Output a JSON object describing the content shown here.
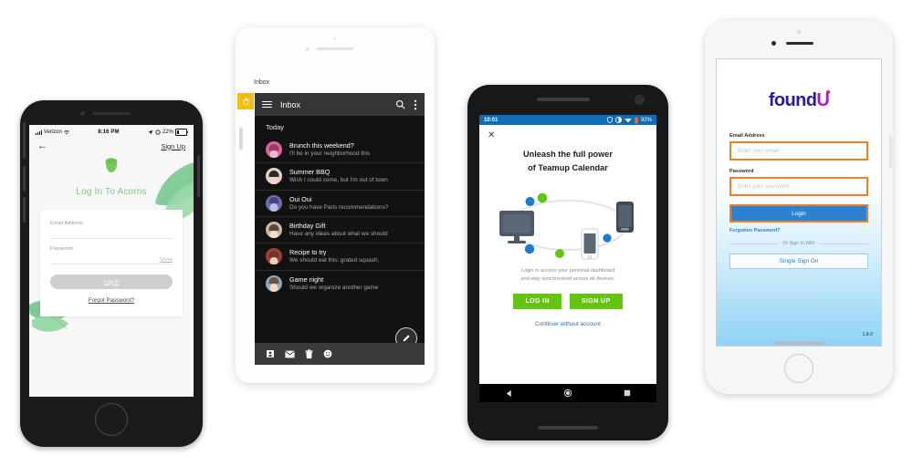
{
  "scene": {
    "title": "Four mobile app login / inbox screens",
    "background": "#ffffff"
  },
  "phones": [
    {
      "id": "acorns",
      "device": "iPhone (space gray)",
      "app": "Acorns",
      "status_bar": {
        "carrier": "Verizon",
        "time": "8:16 PM",
        "battery": "22%"
      },
      "nav": {
        "back_icon": "arrow-left-icon",
        "signup_label": "Sign Up"
      },
      "hero": {
        "logo_icon": "acorn-icon",
        "title": "Log In To Acorns",
        "title_color": "#7dc785"
      },
      "form": {
        "email_label": "Email Address",
        "password_label": "Password",
        "show_label": "Show",
        "login_label": "Log In",
        "forgot_label": "Forgot Password?",
        "button_color": "#cfcfcf"
      }
    },
    {
      "id": "inbox",
      "device": "White phone",
      "app": "Inbox",
      "outer_label": "Inbox",
      "badge_icon": "bag-icon",
      "badge_color": "#f5bc15",
      "appbar": {
        "menu_icon": "hamburger-menu-icon",
        "title": "Inbox",
        "search_icon": "search-icon",
        "overflow_icon": "more-vertical-icon",
        "background": "#353535"
      },
      "section_header": "Today",
      "messages": [
        {
          "subject": "Brunch this weekend?",
          "preview": "I'll be in your neighborhood this",
          "avatar_color": "#e0629c"
        },
        {
          "subject": "Summer BBQ",
          "preview": "Wish I could come, but I'm out of town",
          "avatar_color": "#e8cfc4"
        },
        {
          "subject": "Oui Oui",
          "preview": "Do you have Paris recommendations?",
          "avatar_color": "#6b6fb5"
        },
        {
          "subject": "Birthday Gift",
          "preview": "Have any ideas about what we should",
          "avatar_color": "#cbb7a6"
        },
        {
          "subject": "Recipe to try",
          "preview": "We should eat this: grated squash,",
          "avatar_color": "#a33b3b"
        },
        {
          "subject": "Game night",
          "preview": "Should we organize another game",
          "avatar_color": "#8fa8c4"
        }
      ],
      "bottom_toolbar": [
        {
          "icon": "contact-card-icon"
        },
        {
          "icon": "envelope-icon"
        },
        {
          "icon": "trash-icon"
        },
        {
          "icon": "smiley-icon"
        }
      ],
      "fab_icon": "compose-pen-icon"
    },
    {
      "id": "teamup",
      "device": "Android phone (black)",
      "app": "Teamup Calendar",
      "status_bar": {
        "time": "10:01",
        "battery": "92%",
        "background": "#0f6cb5"
      },
      "close_icon": "close-icon",
      "headline_line1": "Unleash the full power",
      "headline_line2": "of Teamup Calendar",
      "illustration": {
        "name": "devices-sync-illustration",
        "devices": [
          "desktop-monitor-icon",
          "phone-icon",
          "phone-icon"
        ],
        "dot_colors": [
          "#1f7ad6",
          "#63c510"
        ]
      },
      "subtext_line1": "Login to access your personal dashboard",
      "subtext_line2": "and stay synchronized across all devices.",
      "buttons": {
        "login_label": "LOG IN",
        "signup_label": "SIGN UP",
        "color": "#63c510"
      },
      "continue_label": "Continue without account",
      "continue_color": "#2d6fb8",
      "navbar": [
        "back-triangle-icon",
        "home-circle-icon",
        "recents-square-icon"
      ]
    },
    {
      "id": "foundu",
      "device": "iPhone (silver/white)",
      "app": "foundU",
      "logo": {
        "text_a": "found",
        "text_b": "U",
        "color_a": "#2a1a9e",
        "color_b": "#a51fc4",
        "dot_color": "#f0138c"
      },
      "form": {
        "email_label": "Email Address",
        "email_placeholder": "Enter your email",
        "password_label": "Password",
        "password_placeholder": "Enter your password",
        "login_label": "Login",
        "login_color": "#2a82d0",
        "highlight_color": "#ef7f22",
        "forgot_label": "Forgotten Password?",
        "divider_label": "Or Sign In With",
        "sso_label": "Single Sign On"
      },
      "version": "1.8.0"
    }
  ]
}
